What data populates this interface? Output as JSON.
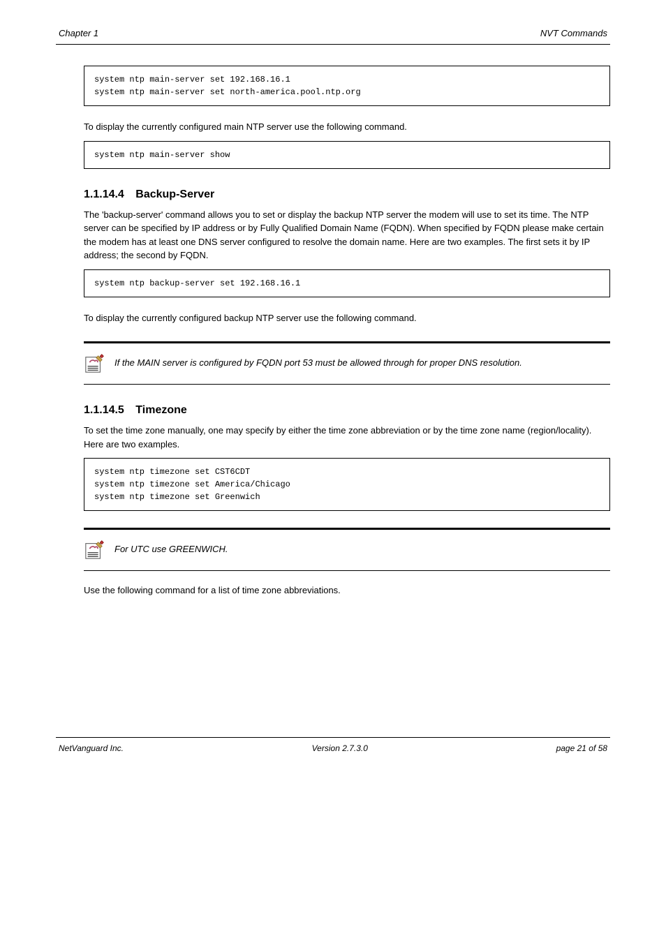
{
  "header": {
    "left": "Chapter 1",
    "right": "NVT Commands"
  },
  "block1": {
    "code": "system ntp main-server set 192.168.16.1\nsystem ntp main-server set north-america.pool.ntp.org"
  },
  "para1": "To display the currently configured main NTP server use the following command.",
  "block2": {
    "code": "system ntp main-server show"
  },
  "section_backup": {
    "number": "1.1.14.4",
    "title": "Backup-Server"
  },
  "para2": "The 'backup-server' command allows you to set or display the backup NTP server the modem will use to set its time. The NTP server can be specified by IP address or by Fully Qualified Domain Name (FQDN). When specified by FQDN please make certain the modem has at least one DNS server configured to resolve the domain name. Here are two examples. The first sets it by IP address; the second by FQDN.",
  "block3": {
    "code": "system ntp backup-server set 192.168.16.1"
  },
  "para3": "To display the currently configured backup NTP server use the following command.",
  "note1": "If the MAIN server is configured by FQDN port 53 must be allowed through for proper DNS resolution.",
  "section_timezone": {
    "number": "1.1.14.5",
    "title": "Timezone"
  },
  "para4": "To set the time zone manually, one may specify by either the time zone abbreviation or by the time zone name (region/locality). Here are two examples.",
  "block4": {
    "code": "system ntp timezone set CST6CDT\nsystem ntp timezone set America/Chicago\nsystem ntp timezone set Greenwich"
  },
  "note2": "For UTC use GREENWICH.",
  "para5": "Use the following command for a list of time zone abbreviations.",
  "footer": {
    "left": "NetVanguard Inc.",
    "center": "Version 2.7.3.0",
    "right": "page 21 of 58"
  }
}
